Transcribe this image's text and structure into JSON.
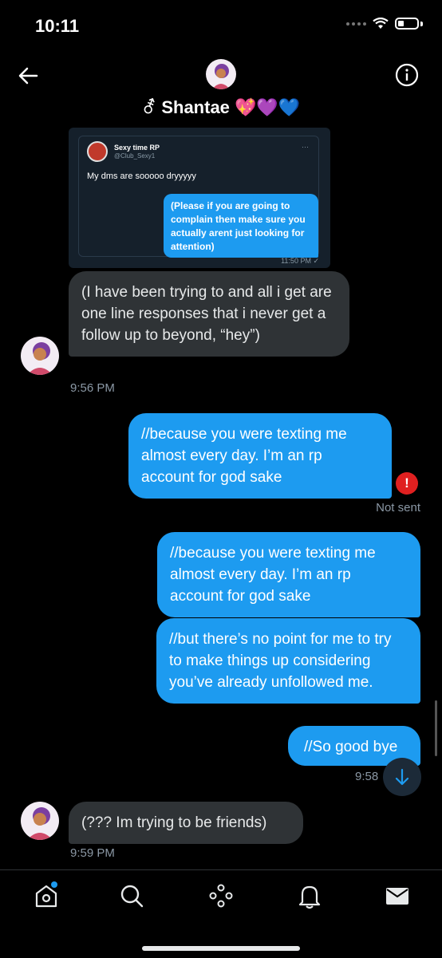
{
  "status_bar": {
    "time": "10:11"
  },
  "header": {
    "name": "⚦ Shantae 💖💜💙"
  },
  "quoted_tweet": {
    "name": "Sexy time RP",
    "handle": "@Club_Sexy1",
    "text": "My dms are sooooo dryyyyy",
    "reply": "(Please if you are going to complain then make sure you actually arent just looking for attention)",
    "time": "11:50 PM ✓"
  },
  "messages": [
    {
      "text": "(I have been trying to and all i get are one line responses that i never get a follow up to beyond, “hey”)",
      "time": "9:56 PM"
    },
    {
      "text": "//because you were texting me almost every day. I’m an rp account for god sake",
      "status": "Not sent"
    },
    {
      "text": "//because you were texting me almost every day. I’m an rp account for god sake"
    },
    {
      "text": "//but there’s no point for me to try to make things up considering you’ve already unfollowed me."
    },
    {
      "text": "//So good bye",
      "time": "9:58"
    },
    {
      "text": "(??? Im trying to be friends)",
      "time": "9:59 PM"
    }
  ],
  "error_icon_text": "!",
  "icons": {
    "back": "back-arrow-icon",
    "info": "info-icon",
    "home": "home-icon",
    "search": "search-icon",
    "spaces": "spaces-icon",
    "notifications": "bell-icon",
    "messages": "mail-icon",
    "scroll_down": "arrow-down-icon"
  },
  "colors": {
    "accent": "#1d9bf0",
    "received_bubble": "#2f3336",
    "error": "#e02020"
  }
}
